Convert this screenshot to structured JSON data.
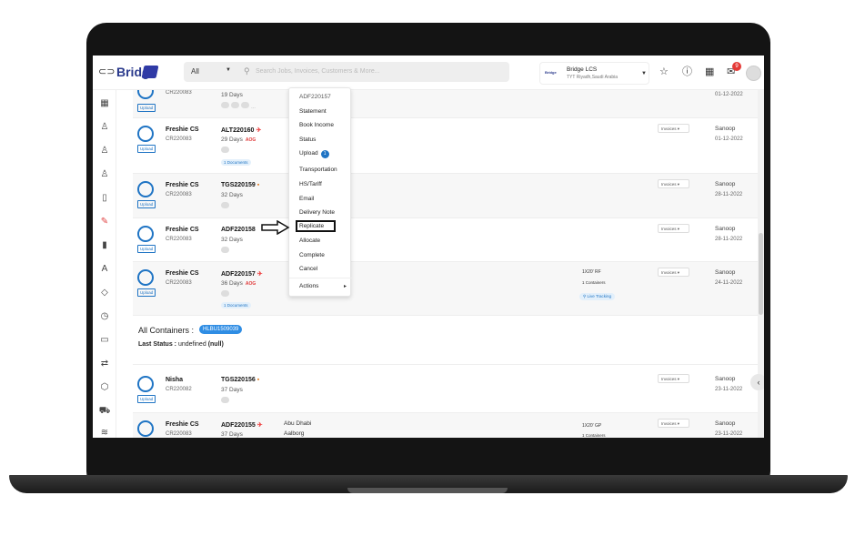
{
  "topbar": {
    "logo": "Bridge",
    "search_scope": "All",
    "search_placeholder": "Search Jobs, Invoices, Customers & More...",
    "company_short": "Bridge",
    "company_name": "Bridge LCS",
    "company_location": "TYT Riyadh,Saudi Arabia",
    "notifications_count": "9"
  },
  "rows": [
    {
      "code": "CR220083",
      "days": "19 Days",
      "date": "01-12-2022",
      "upload": "Upload"
    },
    {
      "customer": "Freshie CS",
      "code": "CR220083",
      "job": "ALT220160",
      "days": "29 Days",
      "aog": "AOG",
      "docs": "1 Documents",
      "invoices": "Invoices",
      "who": "Sanoop",
      "date": "01-12-2022",
      "upload": "Upload"
    },
    {
      "customer": "Freshie CS",
      "code": "CR220083",
      "job": "TGS220159",
      "days": "32 Days",
      "invoices": "Invoices",
      "who": "Sanoop",
      "date": "28-11-2022",
      "upload": "Upload"
    },
    {
      "customer": "Freshie CS",
      "code": "CR220083",
      "job": "ADF220158",
      "days": "32 Days",
      "invoices": "Invoices",
      "who": "Sanoop",
      "date": "28-11-2022",
      "upload": "Upload"
    },
    {
      "customer": "Freshie CS",
      "code": "CR220083",
      "job": "ADF220157",
      "days": "36 Days",
      "aog": "AOG",
      "docs": "1 Documents",
      "cont_type": "1X20' RF",
      "cont_count": "1 Containers",
      "live": "Live Tracking",
      "invoices": "Invoices",
      "who": "Sanoop",
      "date": "24-11-2022",
      "upload": "Upload"
    },
    {
      "customer": "Nisha",
      "code": "CR220082",
      "job": "TGS220156",
      "days": "37 Days",
      "invoices": "Invoices",
      "who": "Sanoop",
      "date": "23-11-2022",
      "upload": "Upload"
    },
    {
      "customer": "Freshie CS",
      "code": "CR220083",
      "job": "ADF220155",
      "days": "37 Days",
      "origin": "Abu Dhabi",
      "dest": "Aalborg",
      "cont_type": "1X20' GP",
      "cont_count": "1 Containers",
      "invoices": "Invoices",
      "who": "Sanoop",
      "date": "23-11-2022"
    }
  ],
  "containers": {
    "label": "All Containers :",
    "badge": "HLBU1509039",
    "status_label": "Last Status :",
    "status_value": "undefined",
    "status_null": "(null)"
  },
  "menu": {
    "header": "ADF220157",
    "items": [
      "Statement",
      "Book Income",
      "Status",
      "Upload",
      "Transportation",
      "HS/Tariff",
      "Email",
      "Delivery Note",
      "Replicate",
      "Allocate",
      "Complete",
      "Cancel",
      "Actions"
    ],
    "upload_count": "1"
  }
}
